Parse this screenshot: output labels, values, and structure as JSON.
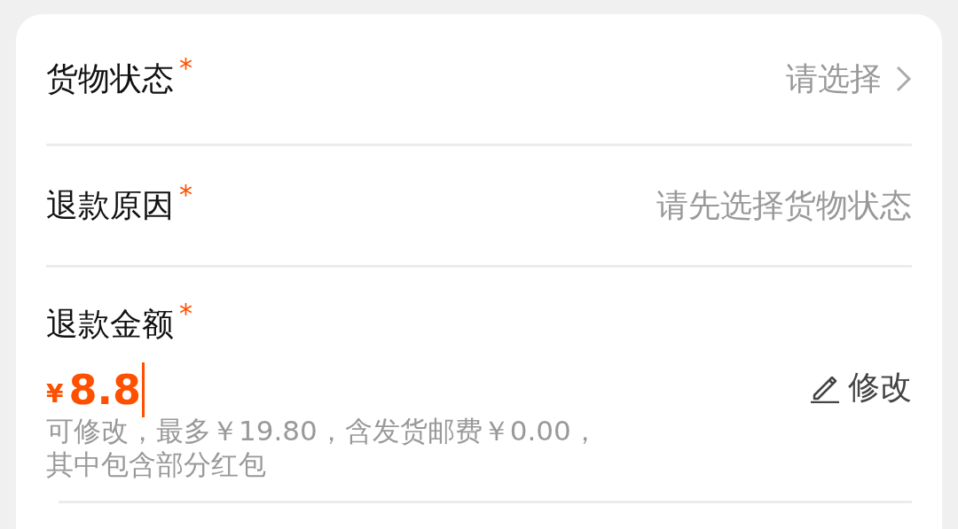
{
  "fields": [
    {
      "label": "货物状态",
      "required_mark": "*",
      "placeholder": "请选择",
      "kind": "select"
    },
    {
      "label": "退款原因",
      "required_mark": "*",
      "placeholder": "请先选择货物状态",
      "kind": "text"
    }
  ],
  "amount": {
    "label": "退款金额",
    "required_mark": "*",
    "currency": "¥",
    "value": "8.8",
    "edit_label": "修改",
    "note": "可修改，最多￥19.80，含发货邮费￥0.00，其中包含部分红包"
  }
}
